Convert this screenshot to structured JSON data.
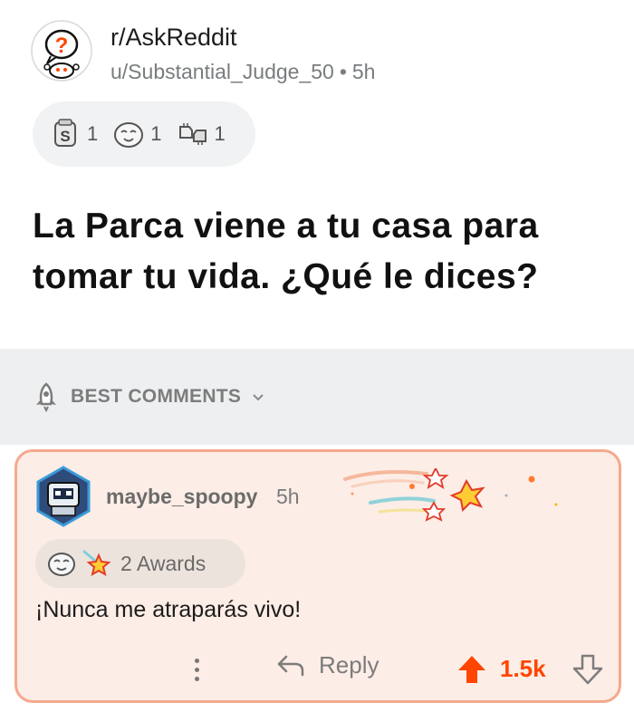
{
  "post": {
    "subreddit": "r/AskReddit",
    "author": "u/Substantial_Judge_50",
    "separator": "•",
    "time": "5h",
    "awards": [
      {
        "icon": "silver-coin-icon",
        "count": "1"
      },
      {
        "icon": "wholesome-face-icon",
        "count": "1"
      },
      {
        "icon": "fist-bump-icon",
        "count": "1"
      }
    ],
    "title": "La Parca viene a tu casa para tomar tu vida. ¿Qué le dices?"
  },
  "sort": {
    "label": "BEST COMMENTS",
    "icon": "rocket-icon"
  },
  "comment": {
    "username": "maybe_spoopy",
    "time": "5h",
    "awards_label": "2 Awards",
    "body": "¡Nunca me atraparás vivo!",
    "reply_label": "Reply",
    "score": "1.5k"
  },
  "colors": {
    "upvote": "#ff4500",
    "comment_bg": "#fcede6",
    "comment_border": "#f5a98e",
    "sort_bar_bg": "#eeeff0"
  }
}
